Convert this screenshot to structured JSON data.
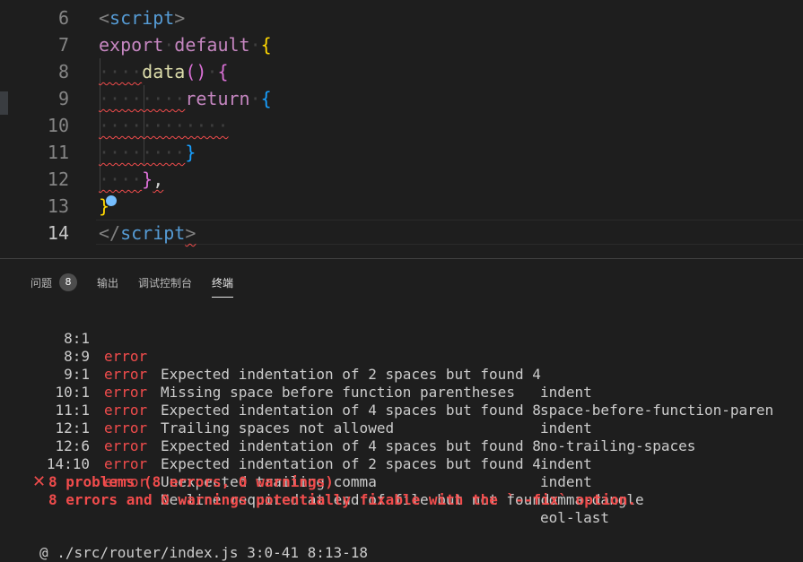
{
  "editor": {
    "lines": [
      {
        "no": "6"
      },
      {
        "no": "7"
      },
      {
        "no": "8"
      },
      {
        "no": "9"
      },
      {
        "no": "10"
      },
      {
        "no": "11"
      },
      {
        "no": "12"
      },
      {
        "no": "13"
      },
      {
        "no": "14"
      }
    ],
    "code": {
      "l6_open": "<",
      "l6_tag": "script",
      "l6_close": ">",
      "l7_export": "export",
      "l7_default": "default",
      "l7_brace": "{",
      "l8_ws": "····",
      "l8_fn": "data",
      "l8_parens": "()",
      "l8_brace": "{",
      "l9_ws": "········",
      "l9_return": "return",
      "l9_brace": "{",
      "l10_ws": "············",
      "l11_ws": "········",
      "l11_brace": "}",
      "l12_ws": "····",
      "l12_brace": "}",
      "l12_comma": ",",
      "l13_brace": "}",
      "l14_open": "</",
      "l14_tag": "script",
      "l14_close": ">"
    }
  },
  "panel": {
    "tabs": [
      {
        "label": "问题",
        "badge": "8"
      },
      {
        "label": "输出"
      },
      {
        "label": "调试控制台"
      },
      {
        "label": "终端"
      }
    ],
    "output": [
      {
        "loc": "8:1",
        "severity": "error",
        "message": "Expected indentation of 2 spaces but found 4",
        "rule": "indent"
      },
      {
        "loc": "8:9",
        "severity": "error",
        "message": "Missing space before function parentheses",
        "rule": "space-before-function-paren"
      },
      {
        "loc": "9:1",
        "severity": "error",
        "message": "Expected indentation of 4 spaces but found 8",
        "rule": "indent"
      },
      {
        "loc": "10:1",
        "severity": "error",
        "message": "Trailing spaces not allowed",
        "rule": "no-trailing-spaces"
      },
      {
        "loc": "11:1",
        "severity": "error",
        "message": "Expected indentation of 4 spaces but found 8",
        "rule": "indent"
      },
      {
        "loc": "12:1",
        "severity": "error",
        "message": "Expected indentation of 2 spaces but found 4",
        "rule": "indent"
      },
      {
        "loc": "12:6",
        "severity": "error",
        "message": "Unexpected trailing comma",
        "rule": "comma-dangle"
      },
      {
        "loc": "14:10",
        "severity": "error",
        "message": "Newline required at end of file but not found",
        "rule": "eol-last"
      }
    ],
    "summary_icon": "✕",
    "summary_line1": "8 problems (8 errors, 0 warnings)",
    "summary_line2": "8 errors and 0 warnings potentially fixable with the `--fix` option.",
    "trace": "@ ./src/router/index.js 3:0-41 8:13-18"
  }
}
